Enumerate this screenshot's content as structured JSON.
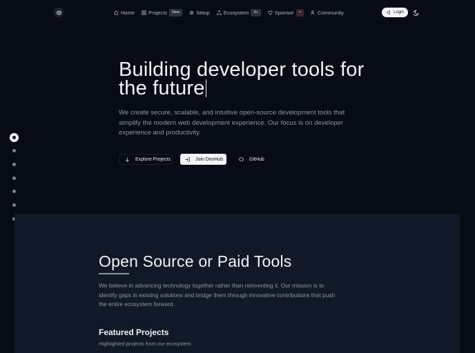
{
  "nav": {
    "logo_icon": "cube-icon",
    "links": [
      {
        "label": "Home",
        "icon": "home-icon"
      },
      {
        "label": "Projects",
        "icon": "grid-icon",
        "badge": "New"
      },
      {
        "label": "Setup",
        "icon": "gear-icon"
      },
      {
        "label": "Ecosystem",
        "icon": "network-icon",
        "badge": "3+"
      },
      {
        "label": "Sponsor",
        "icon": "heart-icon",
        "badge": "♥"
      },
      {
        "label": "Community",
        "icon": "users-icon"
      }
    ],
    "login_label": "Login",
    "theme_icon": "moon-icon"
  },
  "hero": {
    "title_line1": "Building developer tools for",
    "title_line2": "the future",
    "description": "We create secure, scalable, and intuitive open-source development tools that simplify the modern web development experience. Our focus is on developer experience and productivity.",
    "buttons": {
      "explore": "Explore Projects",
      "join": "Join DevHub",
      "github": "GitHub"
    }
  },
  "section": {
    "title": "Open Source or Paid Tools",
    "description": "We believe in advancing technology together rather than reinventing it. Our mission is to identify gaps in existing solutions and bridge them through innovative contributions that push the entire ecosystem forward.",
    "featured_title": "Featured Projects",
    "featured_subtitle": "Highlighted projects from our ecosystem"
  },
  "colors": {
    "background": "#070b15",
    "section_background": "#111827",
    "accent_light": "#f2f4f7",
    "muted_text": "#8e96a4",
    "heart": "#e05a6a"
  }
}
